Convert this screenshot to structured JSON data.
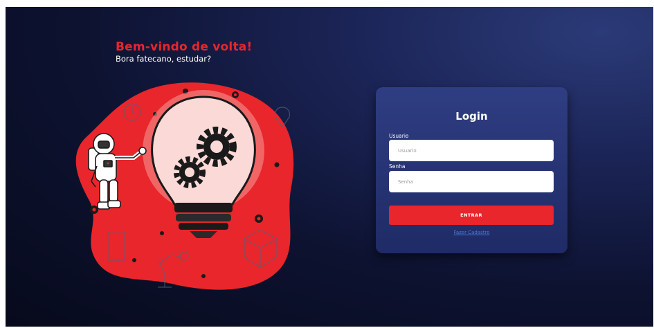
{
  "welcome": {
    "title": "Bem-vindo de volta!",
    "subtitle": "Bora fatecano, estudar?"
  },
  "illustration": {
    "icon": "astronaut-lightbulb-gears-illustration",
    "accent_color": "#e8262b"
  },
  "login": {
    "title": "Login",
    "username_label": "Usuario",
    "username_placeholder": "Usuario",
    "username_value": "",
    "password_label": "Senha",
    "password_placeholder": "Senha",
    "password_value": "",
    "submit_label": "ENTRAR",
    "signup_link": "Fazer Cadastro"
  },
  "colors": {
    "background_dark": "#070a1c",
    "background_light": "#2b3a78",
    "card": "#2f3d82",
    "accent": "#e8262b",
    "link": "#4a78d6"
  }
}
